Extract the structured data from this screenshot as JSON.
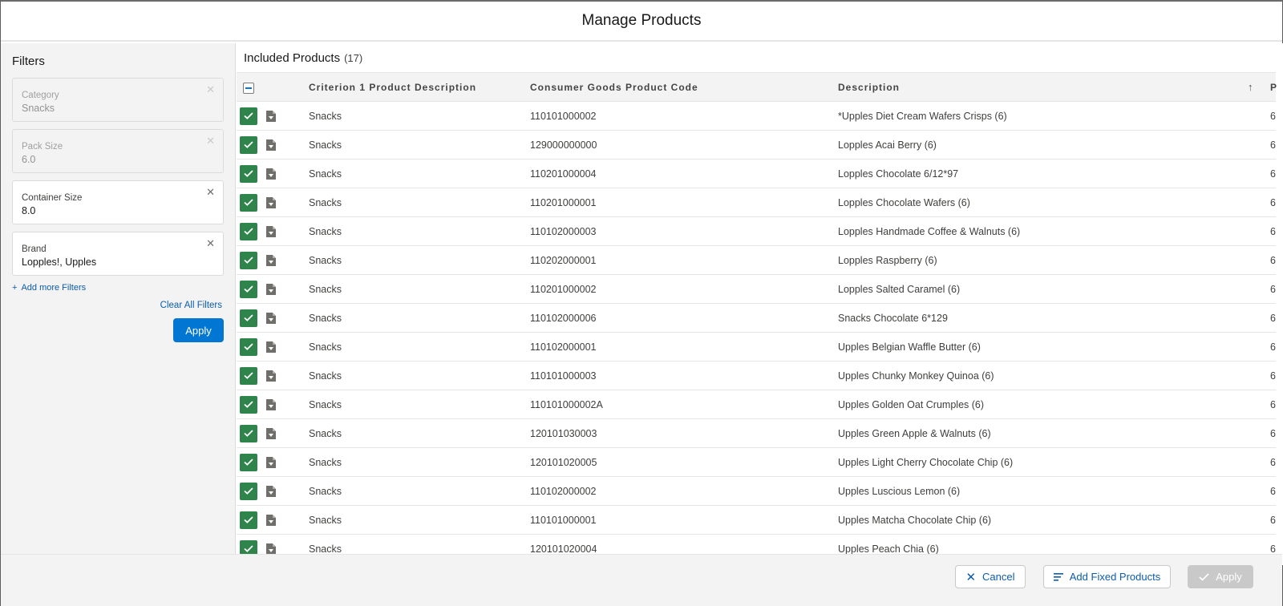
{
  "modal": {
    "title": "Manage Products"
  },
  "sidebar": {
    "title": "Filters",
    "filters": [
      {
        "label": "Category",
        "value": "Snacks",
        "active": false
      },
      {
        "label": "Pack Size",
        "value": "6.0",
        "active": false
      },
      {
        "label": "Container Size",
        "value": "8.0",
        "active": true
      },
      {
        "label": "Brand",
        "value": "Lopples!, Upples",
        "active": true
      }
    ],
    "add_filters_label": "Add more Filters",
    "clear_all_label": "Clear All Filters",
    "apply_label": "Apply"
  },
  "main": {
    "title": "Included Products",
    "count": "(17)",
    "columns": [
      "Criterion 1 Product Description",
      "Consumer Goods Product Code",
      "Description",
      "P"
    ],
    "sort_indicator": "ascending",
    "rows": [
      {
        "criterion": "Snacks",
        "code": "110101000002",
        "description": "*Upples Diet Cream Wafers Crisps (6)",
        "p": "6",
        "checked": true
      },
      {
        "criterion": "Snacks",
        "code": "129000000000",
        "description": "Lopples Acai Berry (6)",
        "p": "6",
        "checked": true
      },
      {
        "criterion": "Snacks",
        "code": "110201000004",
        "description": "Lopples Chocolate 6/12*97",
        "p": "6",
        "checked": true
      },
      {
        "criterion": "Snacks",
        "code": "110201000001",
        "description": "Lopples Chocolate Wafers (6)",
        "p": "6",
        "checked": true
      },
      {
        "criterion": "Snacks",
        "code": "110102000003",
        "description": "Lopples Handmade Coffee & Walnuts (6)",
        "p": "6",
        "checked": true
      },
      {
        "criterion": "Snacks",
        "code": "110202000001",
        "description": "Lopples Raspberry (6)",
        "p": "6",
        "checked": true
      },
      {
        "criterion": "Snacks",
        "code": "110201000002",
        "description": "Lopples Salted Caramel (6)",
        "p": "6",
        "checked": true
      },
      {
        "criterion": "Snacks",
        "code": "110102000006",
        "description": "Snacks Chocolate 6*129",
        "p": "6",
        "checked": true
      },
      {
        "criterion": "Snacks",
        "code": "110102000001",
        "description": "Upples Belgian Waffle Butter (6)",
        "p": "6",
        "checked": true
      },
      {
        "criterion": "Snacks",
        "code": "110101000003",
        "description": "Upples Chunky Monkey Quinoa (6)",
        "p": "6",
        "checked": true
      },
      {
        "criterion": "Snacks",
        "code": "110101000002A",
        "description": "Upples Golden Oat Crumples (6)",
        "p": "6",
        "checked": true
      },
      {
        "criterion": "Snacks",
        "code": "120101030003",
        "description": "Upples Green Apple & Walnuts (6)",
        "p": "6",
        "checked": true
      },
      {
        "criterion": "Snacks",
        "code": "120101020005",
        "description": "Upples Light Cherry Chocolate Chip (6)",
        "p": "6",
        "checked": true
      },
      {
        "criterion": "Snacks",
        "code": "110102000002",
        "description": "Upples Luscious Lemon (6)",
        "p": "6",
        "checked": true
      },
      {
        "criterion": "Snacks",
        "code": "110101000001",
        "description": "Upples Matcha Chocolate Chip (6)",
        "p": "6",
        "checked": true
      },
      {
        "criterion": "Snacks",
        "code": "120101020004",
        "description": "Upples Peach Chia (6)",
        "p": "6",
        "checked": true
      }
    ]
  },
  "footer": {
    "cancel_label": "Cancel",
    "add_fixed_label": "Add Fixed Products",
    "apply_label": "Apply"
  },
  "colors": {
    "brand": "#0176d3",
    "checked": "#2e844a",
    "link": "#0b5cab",
    "disabled": "#c9c9c9"
  }
}
